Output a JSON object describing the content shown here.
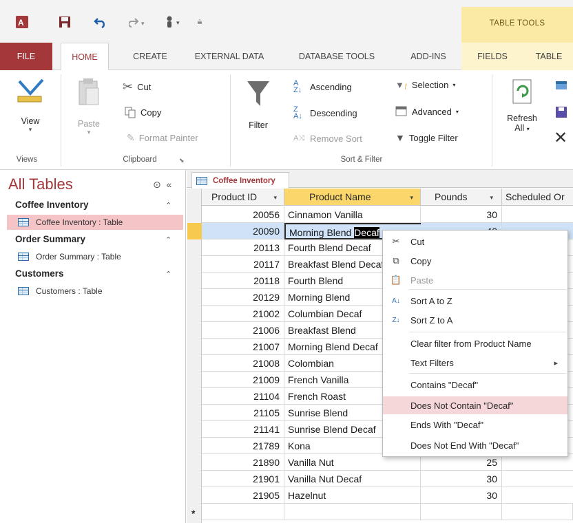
{
  "tabs": [
    "FILE",
    "HOME",
    "CREATE",
    "EXTERNAL DATA",
    "DATABASE TOOLS",
    "ADD-INS",
    "FIELDS",
    "TABLE"
  ],
  "table_tools": "TABLE TOOLS",
  "ribbon": {
    "views": {
      "view": "View",
      "group": "Views"
    },
    "clipboard": {
      "paste": "Paste",
      "cut": "Cut",
      "copy": "Copy",
      "format_painter": "Format Painter",
      "group": "Clipboard"
    },
    "sort_filter": {
      "filter": "Filter",
      "ascending": "Ascending",
      "descending": "Descending",
      "remove_sort": "Remove Sort",
      "selection": "Selection",
      "advanced": "Advanced",
      "toggle_filter": "Toggle Filter",
      "group": "Sort & Filter"
    },
    "records": {
      "refresh": "Refresh",
      "refresh_sub": "All"
    }
  },
  "nav": {
    "title": "All Tables",
    "groups": [
      {
        "name": "Coffee Inventory",
        "item": "Coffee Inventory : Table"
      },
      {
        "name": "Order Summary",
        "item": "Order Summary : Table"
      },
      {
        "name": "Customers",
        "item": "Customers : Table"
      }
    ]
  },
  "doc_tab": "Coffee Inventory",
  "columns": [
    "Product ID",
    "Product Name",
    "Pounds",
    "Scheduled Or"
  ],
  "rows": [
    {
      "id": "20056",
      "name": "Cinnamon Vanilla",
      "pounds": "30"
    },
    {
      "id": "20090",
      "name": "Morning Blend ",
      "sel": "Decaf",
      "pounds": "40"
    },
    {
      "id": "20113",
      "name": "Fourth Blend Decaf",
      "pounds": ""
    },
    {
      "id": "20117",
      "name": "Breakfast Blend Decaf",
      "pounds": ""
    },
    {
      "id": "20118",
      "name": "Fourth Blend",
      "pounds": ""
    },
    {
      "id": "20129",
      "name": "Morning Blend",
      "pounds": ""
    },
    {
      "id": "21002",
      "name": "Columbian Decaf",
      "pounds": ""
    },
    {
      "id": "21006",
      "name": "Breakfast Blend",
      "pounds": ""
    },
    {
      "id": "21007",
      "name": "Morning Blend Decaf",
      "pounds": ""
    },
    {
      "id": "21008",
      "name": "Colombian",
      "pounds": ""
    },
    {
      "id": "21009",
      "name": "French Vanilla",
      "pounds": ""
    },
    {
      "id": "21104",
      "name": "French Roast",
      "pounds": ""
    },
    {
      "id": "21105",
      "name": "Sunrise Blend",
      "pounds": ""
    },
    {
      "id": "21141",
      "name": "Sunrise Blend Decaf",
      "pounds": ""
    },
    {
      "id": "21789",
      "name": "Kona",
      "pounds": ""
    },
    {
      "id": "21890",
      "name": "Vanilla Nut",
      "pounds": "25"
    },
    {
      "id": "21901",
      "name": "Vanilla Nut Decaf",
      "pounds": "30"
    },
    {
      "id": "21905",
      "name": "Hazelnut",
      "pounds": "30"
    }
  ],
  "new_record_marker": "*",
  "context_menu": [
    {
      "label": "Cut",
      "icon": "scissors-icon"
    },
    {
      "label": "Copy",
      "icon": "copy-icon"
    },
    {
      "label": "Paste",
      "icon": "paste-icon",
      "disabled": true
    },
    {
      "label": "Sort A to Z",
      "icon": "sort-asc-icon"
    },
    {
      "label": "Sort Z to A",
      "icon": "sort-desc-icon"
    },
    {
      "label": "Clear filter from Product Name"
    },
    {
      "label": "Text Filters",
      "submenu": true
    },
    {
      "label": "Contains \"Decaf\""
    },
    {
      "label": "Does Not Contain \"Decaf\"",
      "highlighted": true
    },
    {
      "label": "Ends With \"Decaf\""
    },
    {
      "label": "Does Not End With \"Decaf\""
    }
  ],
  "colors": {
    "access_red": "#a4373a",
    "selection_pink": "#f4c4c7",
    "row_select_blue": "#cfe2f7",
    "header_gold": "#fbd66a",
    "table_tools_yellow": "#fbe9a6"
  }
}
